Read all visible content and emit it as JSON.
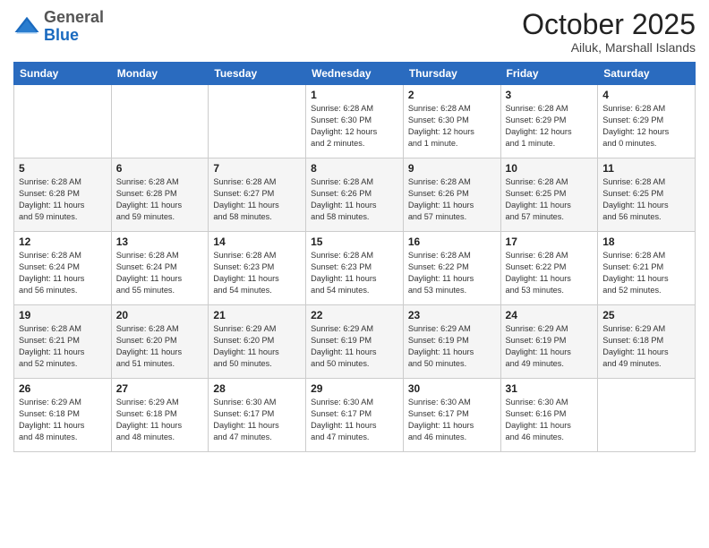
{
  "logo": {
    "general": "General",
    "blue": "Blue"
  },
  "header": {
    "month": "October 2025",
    "location": "Ailuk, Marshall Islands"
  },
  "weekdays": [
    "Sunday",
    "Monday",
    "Tuesday",
    "Wednesday",
    "Thursday",
    "Friday",
    "Saturday"
  ],
  "weeks": [
    [
      {
        "day": "",
        "info": ""
      },
      {
        "day": "",
        "info": ""
      },
      {
        "day": "",
        "info": ""
      },
      {
        "day": "1",
        "info": "Sunrise: 6:28 AM\nSunset: 6:30 PM\nDaylight: 12 hours\nand 2 minutes."
      },
      {
        "day": "2",
        "info": "Sunrise: 6:28 AM\nSunset: 6:30 PM\nDaylight: 12 hours\nand 1 minute."
      },
      {
        "day": "3",
        "info": "Sunrise: 6:28 AM\nSunset: 6:29 PM\nDaylight: 12 hours\nand 1 minute."
      },
      {
        "day": "4",
        "info": "Sunrise: 6:28 AM\nSunset: 6:29 PM\nDaylight: 12 hours\nand 0 minutes."
      }
    ],
    [
      {
        "day": "5",
        "info": "Sunrise: 6:28 AM\nSunset: 6:28 PM\nDaylight: 11 hours\nand 59 minutes."
      },
      {
        "day": "6",
        "info": "Sunrise: 6:28 AM\nSunset: 6:28 PM\nDaylight: 11 hours\nand 59 minutes."
      },
      {
        "day": "7",
        "info": "Sunrise: 6:28 AM\nSunset: 6:27 PM\nDaylight: 11 hours\nand 58 minutes."
      },
      {
        "day": "8",
        "info": "Sunrise: 6:28 AM\nSunset: 6:26 PM\nDaylight: 11 hours\nand 58 minutes."
      },
      {
        "day": "9",
        "info": "Sunrise: 6:28 AM\nSunset: 6:26 PM\nDaylight: 11 hours\nand 57 minutes."
      },
      {
        "day": "10",
        "info": "Sunrise: 6:28 AM\nSunset: 6:25 PM\nDaylight: 11 hours\nand 57 minutes."
      },
      {
        "day": "11",
        "info": "Sunrise: 6:28 AM\nSunset: 6:25 PM\nDaylight: 11 hours\nand 56 minutes."
      }
    ],
    [
      {
        "day": "12",
        "info": "Sunrise: 6:28 AM\nSunset: 6:24 PM\nDaylight: 11 hours\nand 56 minutes."
      },
      {
        "day": "13",
        "info": "Sunrise: 6:28 AM\nSunset: 6:24 PM\nDaylight: 11 hours\nand 55 minutes."
      },
      {
        "day": "14",
        "info": "Sunrise: 6:28 AM\nSunset: 6:23 PM\nDaylight: 11 hours\nand 54 minutes."
      },
      {
        "day": "15",
        "info": "Sunrise: 6:28 AM\nSunset: 6:23 PM\nDaylight: 11 hours\nand 54 minutes."
      },
      {
        "day": "16",
        "info": "Sunrise: 6:28 AM\nSunset: 6:22 PM\nDaylight: 11 hours\nand 53 minutes."
      },
      {
        "day": "17",
        "info": "Sunrise: 6:28 AM\nSunset: 6:22 PM\nDaylight: 11 hours\nand 53 minutes."
      },
      {
        "day": "18",
        "info": "Sunrise: 6:28 AM\nSunset: 6:21 PM\nDaylight: 11 hours\nand 52 minutes."
      }
    ],
    [
      {
        "day": "19",
        "info": "Sunrise: 6:28 AM\nSunset: 6:21 PM\nDaylight: 11 hours\nand 52 minutes."
      },
      {
        "day": "20",
        "info": "Sunrise: 6:28 AM\nSunset: 6:20 PM\nDaylight: 11 hours\nand 51 minutes."
      },
      {
        "day": "21",
        "info": "Sunrise: 6:29 AM\nSunset: 6:20 PM\nDaylight: 11 hours\nand 50 minutes."
      },
      {
        "day": "22",
        "info": "Sunrise: 6:29 AM\nSunset: 6:19 PM\nDaylight: 11 hours\nand 50 minutes."
      },
      {
        "day": "23",
        "info": "Sunrise: 6:29 AM\nSunset: 6:19 PM\nDaylight: 11 hours\nand 50 minutes."
      },
      {
        "day": "24",
        "info": "Sunrise: 6:29 AM\nSunset: 6:19 PM\nDaylight: 11 hours\nand 49 minutes."
      },
      {
        "day": "25",
        "info": "Sunrise: 6:29 AM\nSunset: 6:18 PM\nDaylight: 11 hours\nand 49 minutes."
      }
    ],
    [
      {
        "day": "26",
        "info": "Sunrise: 6:29 AM\nSunset: 6:18 PM\nDaylight: 11 hours\nand 48 minutes."
      },
      {
        "day": "27",
        "info": "Sunrise: 6:29 AM\nSunset: 6:18 PM\nDaylight: 11 hours\nand 48 minutes."
      },
      {
        "day": "28",
        "info": "Sunrise: 6:30 AM\nSunset: 6:17 PM\nDaylight: 11 hours\nand 47 minutes."
      },
      {
        "day": "29",
        "info": "Sunrise: 6:30 AM\nSunset: 6:17 PM\nDaylight: 11 hours\nand 47 minutes."
      },
      {
        "day": "30",
        "info": "Sunrise: 6:30 AM\nSunset: 6:17 PM\nDaylight: 11 hours\nand 46 minutes."
      },
      {
        "day": "31",
        "info": "Sunrise: 6:30 AM\nSunset: 6:16 PM\nDaylight: 11 hours\nand 46 minutes."
      },
      {
        "day": "",
        "info": ""
      }
    ]
  ]
}
